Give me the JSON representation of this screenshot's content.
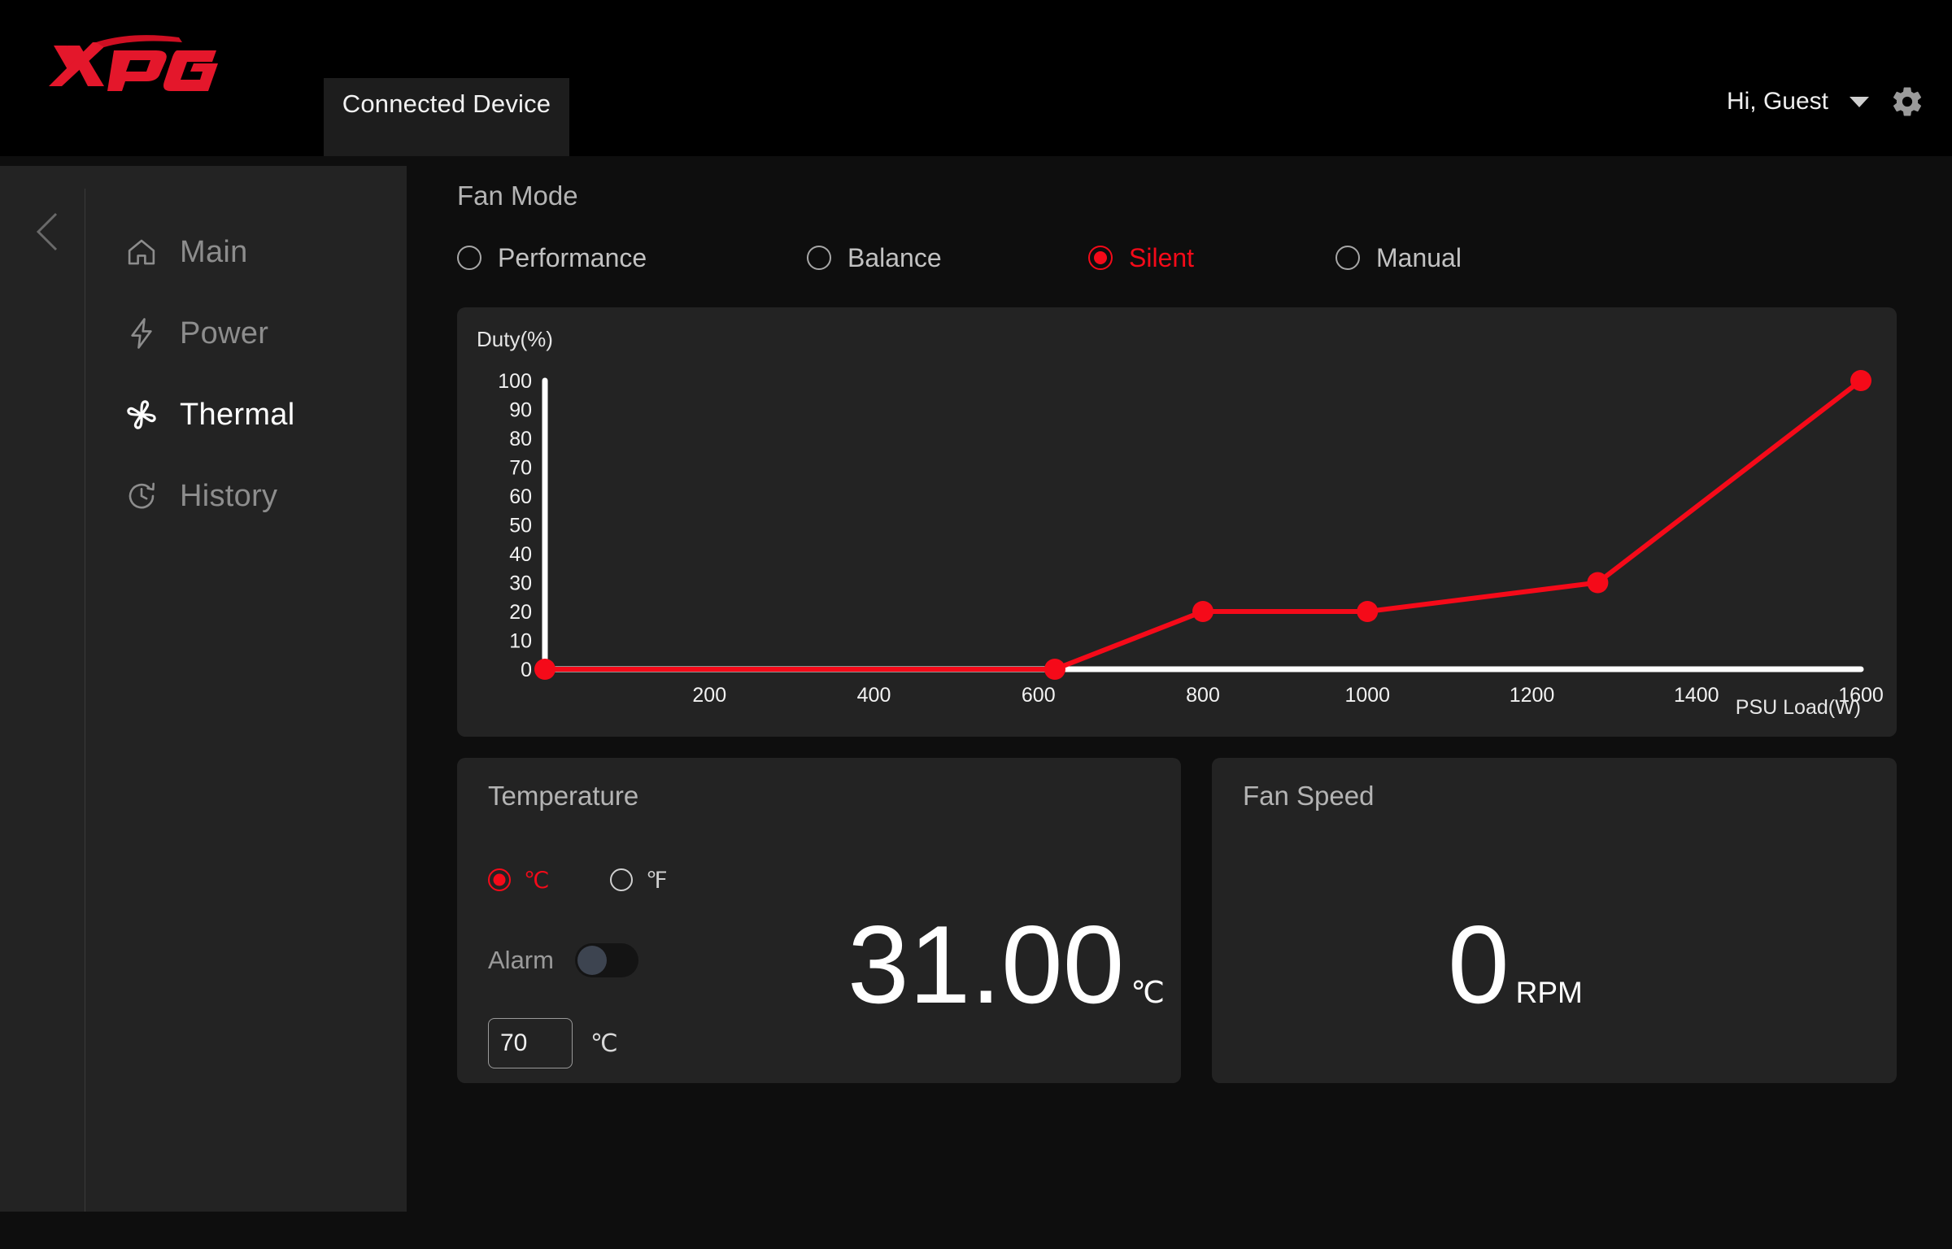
{
  "window": {
    "minimize_label": "–",
    "maximize_label": "□",
    "close_label": "✕"
  },
  "header": {
    "brand": "XPG",
    "tab_label": "Connected Device",
    "user_greeting": "Hi, Guest",
    "settings_icon": "gear-icon",
    "caret_icon": "chevron-down-icon"
  },
  "sidebar": {
    "collapse_icon": "chevron-left-icon",
    "items": [
      {
        "label": "Main",
        "icon": "home-icon",
        "active": false
      },
      {
        "label": "Power",
        "icon": "lightning-icon",
        "active": false
      },
      {
        "label": "Thermal",
        "icon": "fan-icon",
        "active": true
      },
      {
        "label": "History",
        "icon": "clock-icon",
        "active": false
      }
    ]
  },
  "fan_mode": {
    "title": "Fan Mode",
    "options": [
      {
        "label": "Performance",
        "selected": false
      },
      {
        "label": "Balance",
        "selected": false
      },
      {
        "label": "Silent",
        "selected": true
      },
      {
        "label": "Manual",
        "selected": false
      }
    ]
  },
  "temperature": {
    "title": "Temperature",
    "units": [
      {
        "label": "℃",
        "selected": true
      },
      {
        "label": "℉",
        "selected": false
      }
    ],
    "alarm_label": "Alarm",
    "alarm_enabled": false,
    "alarm_threshold": "70",
    "alarm_threshold_unit": "℃",
    "value": "31.00",
    "value_unit": "℃"
  },
  "fan_speed": {
    "title": "Fan Speed",
    "value": "0",
    "value_unit": "RPM"
  },
  "colors": {
    "accent_red": "#f50a19",
    "panel_bg": "#232323",
    "page_bg": "#0e0e0e",
    "axis_white": "#ffffff",
    "text_muted": "#8d8d8d"
  },
  "chart_data": {
    "type": "line",
    "title": "",
    "xlabel": "PSU Load(W)",
    "ylabel": "Duty(%)",
    "xlim": [
      0,
      1600
    ],
    "ylim": [
      0,
      100
    ],
    "xticks": [
      200,
      400,
      600,
      800,
      1000,
      1200,
      1400,
      1600
    ],
    "xtick_labels": [
      "200",
      "400",
      "600",
      "800",
      "1000",
      "1200",
      "1400",
      "1600"
    ],
    "yticks": [
      0,
      10,
      20,
      30,
      40,
      50,
      60,
      70,
      80,
      90,
      100
    ],
    "ytick_labels": [
      "0",
      "10",
      "20",
      "30",
      "40",
      "50",
      "60",
      "70",
      "80",
      "90",
      "100"
    ],
    "grid": false,
    "legend": false,
    "series": [
      {
        "name": "Silent",
        "color": "#f50a19",
        "marker": "circle",
        "x": [
          0,
          620,
          800,
          1000,
          1280,
          1600
        ],
        "y": [
          0,
          0,
          20,
          20,
          30,
          100
        ]
      }
    ]
  }
}
